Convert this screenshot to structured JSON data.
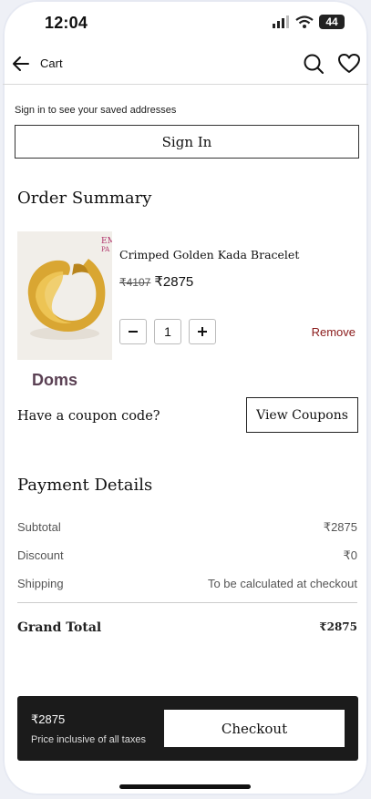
{
  "status_bar": {
    "time": "12:04",
    "battery": "44"
  },
  "header": {
    "title": "Cart"
  },
  "signin": {
    "note": "Sign in to see your saved addresses",
    "button": "Sign In"
  },
  "order_summary": {
    "title": "Order Summary",
    "item": {
      "name": "Crimped Golden Kada Bracelet",
      "original_price": "₹4107",
      "price": "₹2875",
      "quantity": "1",
      "remove_label": "Remove",
      "brand": "Doms"
    }
  },
  "coupon": {
    "question": "Have a coupon code?",
    "button": "View Coupons"
  },
  "payment": {
    "title": "Payment Details",
    "rows": [
      {
        "label": "Subtotal",
        "value": "₹2875"
      },
      {
        "label": "Discount",
        "value": "₹0"
      },
      {
        "label": "Shipping",
        "value": "To be calculated at checkout"
      }
    ],
    "grand_total_label": "Grand Total",
    "grand_total_value": "₹2875"
  },
  "checkout_bar": {
    "price": "₹2875",
    "note": "Price inclusive of all taxes",
    "button": "Checkout"
  },
  "colors": {
    "accent": "#8a1a1a",
    "brand": "#5b4154",
    "bar": "#1b1b1b"
  },
  "icons": [
    "arrow-left-icon",
    "search-icon",
    "heart-icon",
    "minus-icon",
    "plus-icon"
  ]
}
